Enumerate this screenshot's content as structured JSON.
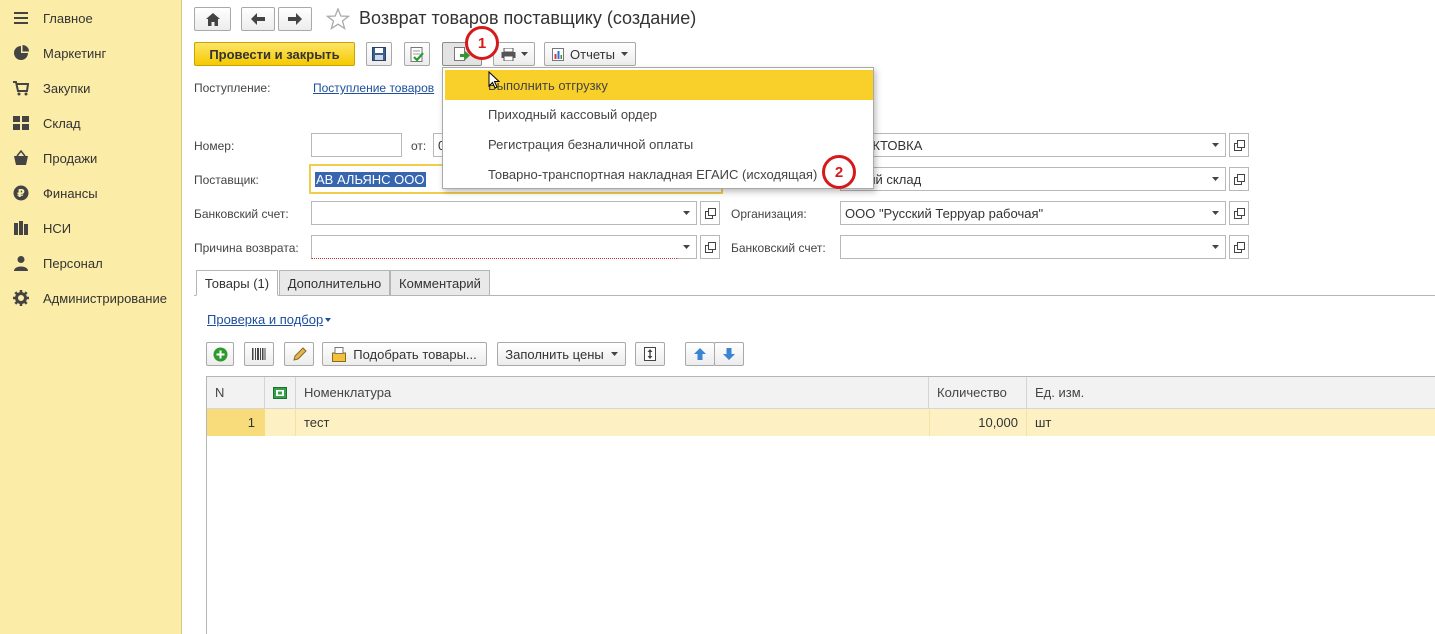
{
  "sidebar": {
    "items": [
      {
        "label": "Главное",
        "icon": "menu-icon"
      },
      {
        "label": "Маркетинг",
        "icon": "pie-chart-icon"
      },
      {
        "label": "Закупки",
        "icon": "cart-icon"
      },
      {
        "label": "Склад",
        "icon": "grid-icon"
      },
      {
        "label": "Продажи",
        "icon": "basket-icon"
      },
      {
        "label": "Финансы",
        "icon": "ruble-icon"
      },
      {
        "label": "НСИ",
        "icon": "books-icon"
      },
      {
        "label": "Персонал",
        "icon": "person-icon"
      },
      {
        "label": "Администрирование",
        "icon": "gear-icon"
      }
    ]
  },
  "header": {
    "title": "Возврат товаров поставщику (создание)"
  },
  "toolbar": {
    "post_close_label": "Провести и закрыть",
    "reports_label": "Отчеты"
  },
  "form": {
    "receipt_label": "Поступление:",
    "receipt_link": "Поступление товаров",
    "number_label": "Номер:",
    "number_value": "",
    "from_label": "от:",
    "from_value": "0",
    "supplier_label": "Поставщик:",
    "supplier_value": "АВ АЛЬЯНС ООО",
    "bank_account_label": "Банковский счет:",
    "bank_account_value": "",
    "return_reason_label": "Причина возврата:",
    "return_reason_value": "",
    "right_field1_value": "ЕНИКТОВКА",
    "right_field2_value": "ичный склад",
    "org_label": "Организация:",
    "org_value": "ООО \"Русский Терруар рабочая\"",
    "org_bank_label": "Банковский счет:",
    "org_bank_value": ""
  },
  "menu": {
    "items": [
      "Выполнить отгрузку",
      "Приходный кассовый ордер",
      "Регистрация безналичной оплаты",
      "Товарно-транспортная накладная ЕГАИС (исходящая)"
    ]
  },
  "badges": [
    "1",
    "2"
  ],
  "tabs": [
    "Товары (1)",
    "Дополнительно",
    "Комментарий"
  ],
  "goods": {
    "check_link": "Проверка и подбор",
    "pick_label": "Подобрать товары...",
    "fill_prices_label": "Заполнить цены",
    "columns": [
      "N",
      "Номенклатура",
      "Количество",
      "Ед. изм."
    ],
    "rows": [
      {
        "n": "1",
        "name": "тест",
        "qty": "10,000",
        "unit": "шт"
      }
    ]
  },
  "colors": {
    "sidebar_bg": "#fbeca7",
    "accent_yellow": "#f9cf2a",
    "badge_red": "#d41a1a",
    "row_highlight": "#fdf1c3",
    "link_blue": "#1d4fa0"
  }
}
